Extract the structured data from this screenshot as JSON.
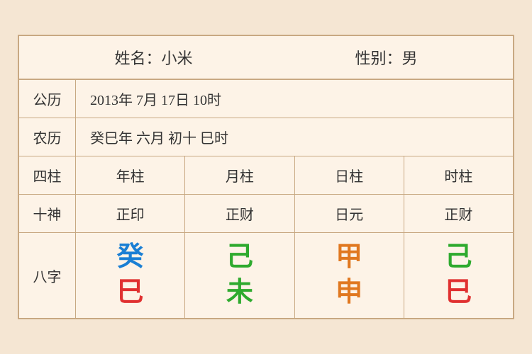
{
  "header": {
    "name_label": "姓名：小米",
    "gender_label": "性别：男"
  },
  "gregorian": {
    "label": "公历",
    "value": "2013年 7月 17日 10时"
  },
  "lunar": {
    "label": "农历",
    "value": "癸巳年 六月 初十 巳时"
  },
  "sizhu": {
    "label": "四柱",
    "columns": [
      "年柱",
      "月柱",
      "日柱",
      "时柱"
    ]
  },
  "shishen": {
    "label": "十神",
    "columns": [
      "正印",
      "正财",
      "日元",
      "正财"
    ]
  },
  "bazhi": {
    "label": "八字",
    "columns": [
      {
        "top": "癸",
        "bottom": "巳",
        "top_color": "blue",
        "bottom_color": "red"
      },
      {
        "top": "己",
        "bottom": "未",
        "top_color": "green",
        "bottom_color": "green"
      },
      {
        "top": "甲",
        "bottom": "申",
        "top_color": "orange",
        "bottom_color": "orange"
      },
      {
        "top": "己",
        "bottom": "巳",
        "top_color": "green",
        "bottom_color": "red"
      }
    ]
  }
}
